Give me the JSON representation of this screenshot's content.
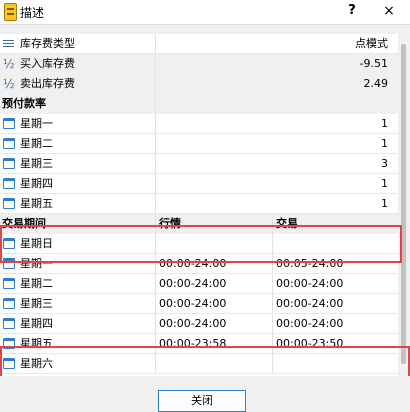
{
  "window": {
    "title": "描述",
    "help": "?",
    "close": "×"
  },
  "swap": {
    "type_label": "库存费类型",
    "type_value": "点模式",
    "buy_label": "买入库存费",
    "buy_value": "-9.51",
    "sell_label": "卖出库存费",
    "sell_value": "2.49"
  },
  "prepay": {
    "header": "预付款率",
    "rows": [
      {
        "label": "星期一",
        "value": "1"
      },
      {
        "label": "星期二",
        "value": "1"
      },
      {
        "label": "星期三",
        "value": "3"
      },
      {
        "label": "星期四",
        "value": "1"
      },
      {
        "label": "星期五",
        "value": "1"
      }
    ]
  },
  "sessions": {
    "headers": [
      "交易期间",
      "行情",
      "交易"
    ],
    "rows": [
      {
        "label": "星期日",
        "quotes": "",
        "trade": ""
      },
      {
        "label": "星期一",
        "quotes": "00:00-24:00",
        "trade": "00:05-24:00"
      },
      {
        "label": "星期二",
        "quotes": "00:00-24:00",
        "trade": "00:00-24:00"
      },
      {
        "label": "星期三",
        "quotes": "00:00-24:00",
        "trade": "00:00-24:00"
      },
      {
        "label": "星期四",
        "quotes": "00:00-24:00",
        "trade": "00:00-24:00"
      },
      {
        "label": "星期五",
        "quotes": "00:00-23:58",
        "trade": "00:00-23:50"
      },
      {
        "label": "星期六",
        "quotes": "",
        "trade": ""
      }
    ]
  },
  "footer": {
    "close_label": "关闭"
  },
  "colors": {
    "highlight": "#e0454a",
    "accent": "#2f7fc7"
  },
  "icons": {
    "app": "app-icon",
    "swap_type": "list-icon",
    "swap_rate": "fraction-icon",
    "day": "calendar-icon"
  }
}
